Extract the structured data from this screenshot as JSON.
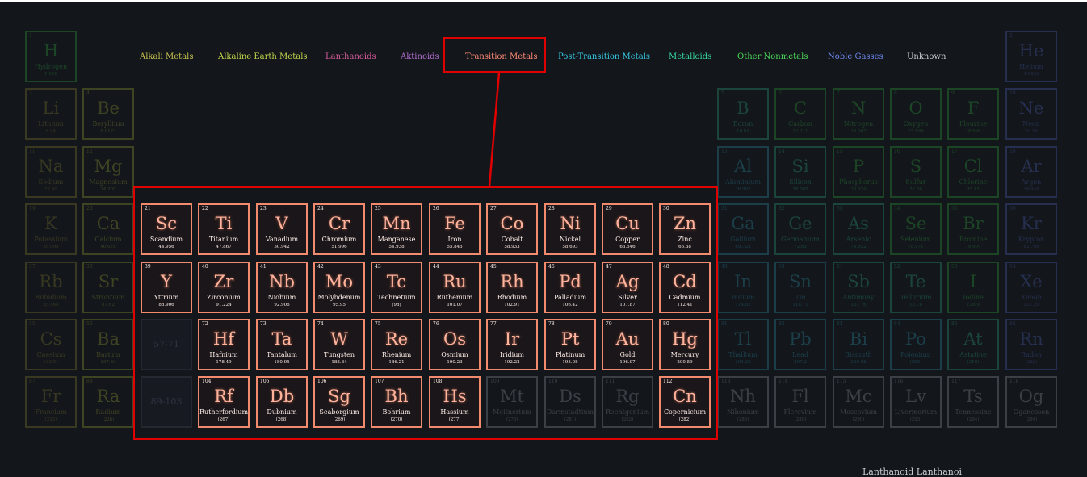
{
  "legend": [
    {
      "label": "Alkali Metals",
      "category": "alkali"
    },
    {
      "label": "Alkaline Earth Metals",
      "category": "alkaline"
    },
    {
      "label": "Lanthanoids",
      "category": "lanthanoid"
    },
    {
      "label": "Aktinoids",
      "category": "actinoid"
    },
    {
      "label": "Transition Metals",
      "category": "transition"
    },
    {
      "label": "Post-Transition Metals",
      "category": "posttransition"
    },
    {
      "label": "Metalloids",
      "category": "metalloid"
    },
    {
      "label": "Other Nonmetals",
      "category": "nonmetal"
    },
    {
      "label": "Noble Gasses",
      "category": "noble"
    },
    {
      "label": "Unknown",
      "category": "unknown"
    }
  ],
  "category_colors": {
    "alkali": "#7d7a2c",
    "alkaline": "#8a9b30",
    "lanthanoid": "#b0527a",
    "actinoid": "#9a5aa8",
    "transition": "#f28b6e",
    "posttransition": "#2a8aa0",
    "metalloid": "#2a9e74",
    "nonmetal": "#2f9e3c",
    "noble": "#4a5fb0",
    "unknown": "#8a8f96"
  },
  "legend_colors": {
    "alkali": "#c7c24e",
    "alkaline": "#c2d84c",
    "lanthanoid": "#d85d9c",
    "actinoid": "#b66fd1",
    "transition": "#ff8a75",
    "posttransition": "#36c6e0",
    "metalloid": "#37d6a0",
    "nonmetal": "#4ddb5a",
    "noble": "#6f8af2",
    "unknown": "#c8ccd2"
  },
  "placeholders": [
    {
      "label": "57-71",
      "row": 6,
      "col": 3
    },
    {
      "label": "89-103",
      "row": 7,
      "col": 3
    }
  ],
  "highlighted_category": "transition",
  "elements": [
    {
      "n": "1",
      "s": "H",
      "name": "Hydrogen",
      "m": "1.008",
      "row": 1,
      "col": 1,
      "c": "nonmetal"
    },
    {
      "n": "2",
      "s": "He",
      "name": "Helium",
      "m": "4.0026",
      "row": 1,
      "col": 18,
      "c": "noble"
    },
    {
      "n": "3",
      "s": "Li",
      "name": "Lithium",
      "m": "6.94",
      "row": 2,
      "col": 1,
      "c": "alkali"
    },
    {
      "n": "4",
      "s": "Be",
      "name": "Beryllium",
      "m": "9.0122",
      "row": 2,
      "col": 2,
      "c": "alkaline"
    },
    {
      "n": "5",
      "s": "B",
      "name": "Boron",
      "m": "10.81",
      "row": 2,
      "col": 13,
      "c": "metalloid"
    },
    {
      "n": "6",
      "s": "C",
      "name": "Carbon",
      "m": "12.011",
      "row": 2,
      "col": 14,
      "c": "nonmetal"
    },
    {
      "n": "7",
      "s": "N",
      "name": "Nitrogen",
      "m": "14.007",
      "row": 2,
      "col": 15,
      "c": "nonmetal"
    },
    {
      "n": "8",
      "s": "O",
      "name": "Oxygen",
      "m": "15.999",
      "row": 2,
      "col": 16,
      "c": "nonmetal"
    },
    {
      "n": "9",
      "s": "F",
      "name": "Flourine",
      "m": "18.998",
      "row": 2,
      "col": 17,
      "c": "nonmetal"
    },
    {
      "n": "10",
      "s": "Ne",
      "name": "Neon",
      "m": "20.18",
      "row": 2,
      "col": 18,
      "c": "noble"
    },
    {
      "n": "11",
      "s": "Na",
      "name": "Sodium",
      "m": "22.99",
      "row": 3,
      "col": 1,
      "c": "alkali"
    },
    {
      "n": "12",
      "s": "Mg",
      "name": "Magnesium",
      "m": "24.305",
      "row": 3,
      "col": 2,
      "c": "alkaline"
    },
    {
      "n": "13",
      "s": "Al",
      "name": "Aluminium",
      "m": "26.982",
      "row": 3,
      "col": 13,
      "c": "posttransition"
    },
    {
      "n": "14",
      "s": "Si",
      "name": "Silicon",
      "m": "28.085",
      "row": 3,
      "col": 14,
      "c": "metalloid"
    },
    {
      "n": "15",
      "s": "P",
      "name": "Phosphorus",
      "m": "30.974",
      "row": 3,
      "col": 15,
      "c": "nonmetal"
    },
    {
      "n": "16",
      "s": "S",
      "name": "Sulfur",
      "m": "32.06",
      "row": 3,
      "col": 16,
      "c": "nonmetal"
    },
    {
      "n": "17",
      "s": "Cl",
      "name": "Chlorine",
      "m": "35.45",
      "row": 3,
      "col": 17,
      "c": "nonmetal"
    },
    {
      "n": "18",
      "s": "Ar",
      "name": "Argon",
      "m": "39.948",
      "row": 3,
      "col": 18,
      "c": "noble"
    },
    {
      "n": "19",
      "s": "K",
      "name": "Potassium",
      "m": "39.098",
      "row": 4,
      "col": 1,
      "c": "alkali"
    },
    {
      "n": "20",
      "s": "Ca",
      "name": "Calcium",
      "m": "40.078",
      "row": 4,
      "col": 2,
      "c": "alkaline"
    },
    {
      "n": "21",
      "s": "Sc",
      "name": "Scandium",
      "m": "44.956",
      "row": 4,
      "col": 3,
      "c": "transition"
    },
    {
      "n": "22",
      "s": "Ti",
      "name": "Titanium",
      "m": "47.867",
      "row": 4,
      "col": 4,
      "c": "transition"
    },
    {
      "n": "23",
      "s": "V",
      "name": "Vanadium",
      "m": "50.942",
      "row": 4,
      "col": 5,
      "c": "transition"
    },
    {
      "n": "24",
      "s": "Cr",
      "name": "Chromium",
      "m": "51.996",
      "row": 4,
      "col": 6,
      "c": "transition"
    },
    {
      "n": "25",
      "s": "Mn",
      "name": "Manganese",
      "m": "54.938",
      "row": 4,
      "col": 7,
      "c": "transition"
    },
    {
      "n": "26",
      "s": "Fe",
      "name": "Iron",
      "m": "55.845",
      "row": 4,
      "col": 8,
      "c": "transition"
    },
    {
      "n": "27",
      "s": "Co",
      "name": "Cobalt",
      "m": "58.933",
      "row": 4,
      "col": 9,
      "c": "transition"
    },
    {
      "n": "28",
      "s": "Ni",
      "name": "Nickel",
      "m": "58.693",
      "row": 4,
      "col": 10,
      "c": "transition"
    },
    {
      "n": "29",
      "s": "Cu",
      "name": "Copper",
      "m": "63.546",
      "row": 4,
      "col": 11,
      "c": "transition"
    },
    {
      "n": "30",
      "s": "Zn",
      "name": "Zinc",
      "m": "65.38",
      "row": 4,
      "col": 12,
      "c": "transition"
    },
    {
      "n": "31",
      "s": "Ga",
      "name": "Gallium",
      "m": "69.723",
      "row": 4,
      "col": 13,
      "c": "posttransition"
    },
    {
      "n": "32",
      "s": "Ge",
      "name": "Germanium",
      "m": "72.63",
      "row": 4,
      "col": 14,
      "c": "metalloid"
    },
    {
      "n": "33",
      "s": "As",
      "name": "Arsenic",
      "m": "74.922",
      "row": 4,
      "col": 15,
      "c": "metalloid"
    },
    {
      "n": "34",
      "s": "Se",
      "name": "Selenium",
      "m": "78.971",
      "row": 4,
      "col": 16,
      "c": "nonmetal"
    },
    {
      "n": "35",
      "s": "Br",
      "name": "Bromine",
      "m": "79.904",
      "row": 4,
      "col": 17,
      "c": "nonmetal"
    },
    {
      "n": "36",
      "s": "Kr",
      "name": "Krypton",
      "m": "83.798",
      "row": 4,
      "col": 18,
      "c": "noble"
    },
    {
      "n": "37",
      "s": "Rb",
      "name": "Rubidium",
      "m": "85.468",
      "row": 5,
      "col": 1,
      "c": "alkali"
    },
    {
      "n": "38",
      "s": "Sr",
      "name": "Strontium",
      "m": "87.62",
      "row": 5,
      "col": 2,
      "c": "alkaline"
    },
    {
      "n": "39",
      "s": "Y",
      "name": "Yttrium",
      "m": "88.906",
      "row": 5,
      "col": 3,
      "c": "transition"
    },
    {
      "n": "40",
      "s": "Zr",
      "name": "Zirconium",
      "m": "91.224",
      "row": 5,
      "col": 4,
      "c": "transition"
    },
    {
      "n": "41",
      "s": "Nb",
      "name": "Niobium",
      "m": "92.906",
      "row": 5,
      "col": 5,
      "c": "transition"
    },
    {
      "n": "42",
      "s": "Mo",
      "name": "Molybdenum",
      "m": "95.95",
      "row": 5,
      "col": 6,
      "c": "transition"
    },
    {
      "n": "43",
      "s": "Tc",
      "name": "Technetium",
      "m": "(98)",
      "row": 5,
      "col": 7,
      "c": "transition"
    },
    {
      "n": "44",
      "s": "Ru",
      "name": "Ruthenium",
      "m": "101.07",
      "row": 5,
      "col": 8,
      "c": "transition"
    },
    {
      "n": "45",
      "s": "Rh",
      "name": "Rhodium",
      "m": "102.91",
      "row": 5,
      "col": 9,
      "c": "transition"
    },
    {
      "n": "46",
      "s": "Pd",
      "name": "Palladium",
      "m": "106.42",
      "row": 5,
      "col": 10,
      "c": "transition"
    },
    {
      "n": "47",
      "s": "Ag",
      "name": "Silver",
      "m": "107.87",
      "row": 5,
      "col": 11,
      "c": "transition"
    },
    {
      "n": "48",
      "s": "Cd",
      "name": "Cadmium",
      "m": "112.41",
      "row": 5,
      "col": 12,
      "c": "transition"
    },
    {
      "n": "49",
      "s": "In",
      "name": "Indium",
      "m": "114.82",
      "row": 5,
      "col": 13,
      "c": "posttransition"
    },
    {
      "n": "50",
      "s": "Sn",
      "name": "Tin",
      "m": "118.71",
      "row": 5,
      "col": 14,
      "c": "posttransition"
    },
    {
      "n": "51",
      "s": "Sb",
      "name": "Antimony",
      "m": "121.76",
      "row": 5,
      "col": 15,
      "c": "metalloid"
    },
    {
      "n": "52",
      "s": "Te",
      "name": "Tellurium",
      "m": "127.6",
      "row": 5,
      "col": 16,
      "c": "metalloid"
    },
    {
      "n": "53",
      "s": "I",
      "name": "Iodine",
      "m": "126.9",
      "row": 5,
      "col": 17,
      "c": "nonmetal"
    },
    {
      "n": "54",
      "s": "Xe",
      "name": "Xenon",
      "m": "131.29",
      "row": 5,
      "col": 18,
      "c": "noble"
    },
    {
      "n": "55",
      "s": "Cs",
      "name": "Caesium",
      "m": "132.91",
      "row": 6,
      "col": 1,
      "c": "alkali"
    },
    {
      "n": "56",
      "s": "Ba",
      "name": "Barium",
      "m": "137.33",
      "row": 6,
      "col": 2,
      "c": "alkaline"
    },
    {
      "n": "72",
      "s": "Hf",
      "name": "Hafnium",
      "m": "178.49",
      "row": 6,
      "col": 4,
      "c": "transition"
    },
    {
      "n": "73",
      "s": "Ta",
      "name": "Tantalum",
      "m": "180.95",
      "row": 6,
      "col": 5,
      "c": "transition"
    },
    {
      "n": "74",
      "s": "W",
      "name": "Tungsten",
      "m": "183.84",
      "row": 6,
      "col": 6,
      "c": "transition"
    },
    {
      "n": "75",
      "s": "Re",
      "name": "Rhenium",
      "m": "186.21",
      "row": 6,
      "col": 7,
      "c": "transition"
    },
    {
      "n": "76",
      "s": "Os",
      "name": "Osmium",
      "m": "190.23",
      "row": 6,
      "col": 8,
      "c": "transition"
    },
    {
      "n": "77",
      "s": "Ir",
      "name": "Iridium",
      "m": "192.22",
      "row": 6,
      "col": 9,
      "c": "transition"
    },
    {
      "n": "78",
      "s": "Pt",
      "name": "Platinum",
      "m": "195.08",
      "row": 6,
      "col": 10,
      "c": "transition"
    },
    {
      "n": "79",
      "s": "Au",
      "name": "Gold",
      "m": "196.97",
      "row": 6,
      "col": 11,
      "c": "transition"
    },
    {
      "n": "80",
      "s": "Hg",
      "name": "Mercury",
      "m": "200.59",
      "row": 6,
      "col": 12,
      "c": "transition"
    },
    {
      "n": "81",
      "s": "Tl",
      "name": "Thallium",
      "m": "204.38",
      "row": 6,
      "col": 13,
      "c": "posttransition"
    },
    {
      "n": "82",
      "s": "Pb",
      "name": "Lead",
      "m": "207.2",
      "row": 6,
      "col": 14,
      "c": "posttransition"
    },
    {
      "n": "83",
      "s": "Bi",
      "name": "Bismuth",
      "m": "208.98",
      "row": 6,
      "col": 15,
      "c": "posttransition"
    },
    {
      "n": "84",
      "s": "Po",
      "name": "Polonium",
      "m": "(209)",
      "row": 6,
      "col": 16,
      "c": "posttransition"
    },
    {
      "n": "85",
      "s": "At",
      "name": "Astatine",
      "m": "(210)",
      "row": 6,
      "col": 17,
      "c": "metalloid"
    },
    {
      "n": "86",
      "s": "Rn",
      "name": "Radon",
      "m": "(222)",
      "row": 6,
      "col": 18,
      "c": "noble"
    },
    {
      "n": "87",
      "s": "Fr",
      "name": "Francium",
      "m": "(223)",
      "row": 7,
      "col": 1,
      "c": "alkali"
    },
    {
      "n": "88",
      "s": "Ra",
      "name": "Radium",
      "m": "(226)",
      "row": 7,
      "col": 2,
      "c": "alkaline"
    },
    {
      "n": "104",
      "s": "Rf",
      "name": "Rutherfordium",
      "m": "(267)",
      "row": 7,
      "col": 4,
      "c": "transition"
    },
    {
      "n": "105",
      "s": "Db",
      "name": "Dubnium",
      "m": "(268)",
      "row": 7,
      "col": 5,
      "c": "transition"
    },
    {
      "n": "106",
      "s": "Sg",
      "name": "Seaborgium",
      "m": "(269)",
      "row": 7,
      "col": 6,
      "c": "transition"
    },
    {
      "n": "107",
      "s": "Bh",
      "name": "Bohrium",
      "m": "(270)",
      "row": 7,
      "col": 7,
      "c": "transition"
    },
    {
      "n": "108",
      "s": "Hs",
      "name": "Hassium",
      "m": "(277)",
      "row": 7,
      "col": 8,
      "c": "transition"
    },
    {
      "n": "109",
      "s": "Mt",
      "name": "Meitnerium",
      "m": "(278)",
      "row": 7,
      "col": 9,
      "c": "unknown"
    },
    {
      "n": "110",
      "s": "Ds",
      "name": "Darmstadtium",
      "m": "(281)",
      "row": 7,
      "col": 10,
      "c": "unknown"
    },
    {
      "n": "111",
      "s": "Rg",
      "name": "Roentgenium",
      "m": "(282)",
      "row": 7,
      "col": 11,
      "c": "unknown"
    },
    {
      "n": "112",
      "s": "Cn",
      "name": "Copernicium",
      "m": "(282)",
      "row": 7,
      "col": 12,
      "c": "transition"
    },
    {
      "n": "113",
      "s": "Nh",
      "name": "Nihonium",
      "m": "(286)",
      "row": 7,
      "col": 13,
      "c": "unknown"
    },
    {
      "n": "114",
      "s": "Fl",
      "name": "Flerovium",
      "m": "(289)",
      "row": 7,
      "col": 14,
      "c": "unknown"
    },
    {
      "n": "115",
      "s": "Mc",
      "name": "Moscovium",
      "m": "(290)",
      "row": 7,
      "col": 15,
      "c": "unknown"
    },
    {
      "n": "116",
      "s": "Lv",
      "name": "Livermorium",
      "m": "(293)",
      "row": 7,
      "col": 16,
      "c": "unknown"
    },
    {
      "n": "117",
      "s": "Ts",
      "name": "Tennessine",
      "m": "(294)",
      "row": 7,
      "col": 17,
      "c": "unknown"
    },
    {
      "n": "118",
      "s": "Og",
      "name": "Oganesson",
      "m": "(294)",
      "row": 7,
      "col": 18,
      "c": "unknown"
    }
  ],
  "footer": {
    "partial_text": "Lanthanoid Lanthanoi"
  }
}
